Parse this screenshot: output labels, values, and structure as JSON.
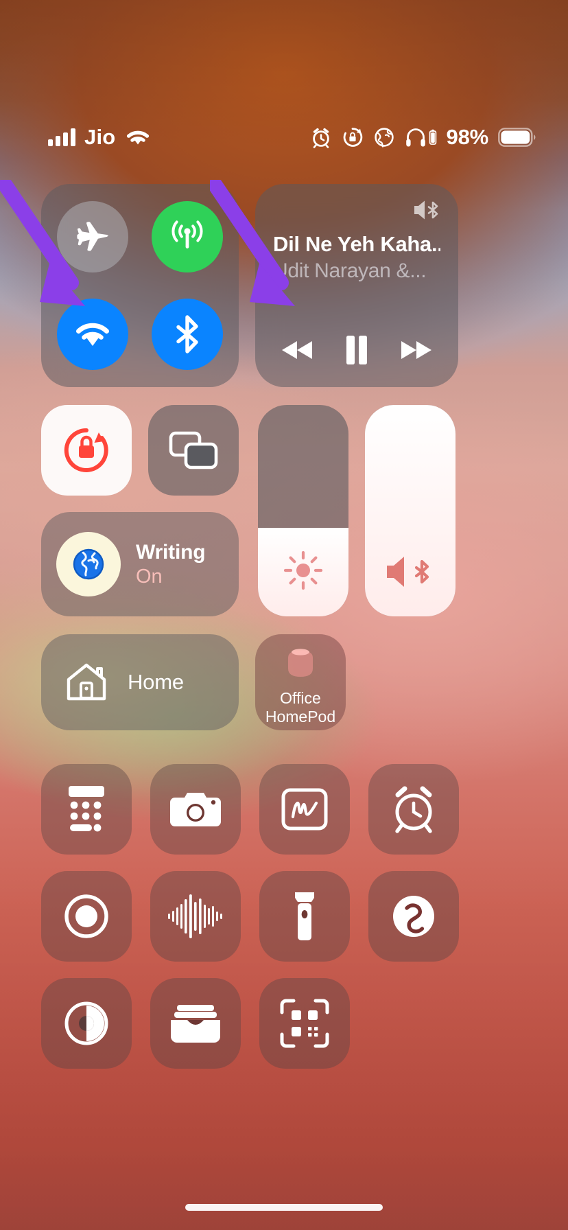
{
  "status_bar": {
    "carrier": "Jio",
    "battery_percent": "98%",
    "icons": [
      "signal-bars-icon",
      "wifi-icon",
      "alarm-icon",
      "rotation-lock-icon",
      "vpn-globe-icon",
      "headphones-battery-icon",
      "battery-icon"
    ]
  },
  "connectivity": {
    "airplane": {
      "name": "Airplane Mode",
      "state": "off",
      "color": "#b0b0b5"
    },
    "cellular": {
      "name": "Cellular Data",
      "state": "on",
      "color": "#2fd158"
    },
    "wifi": {
      "name": "Wi-Fi",
      "state": "on",
      "color": "#0a84ff"
    },
    "bluetooth": {
      "name": "Bluetooth",
      "state": "on",
      "color": "#0a84ff"
    }
  },
  "media": {
    "track_title": "Dil Ne Yeh Kaha...",
    "artist": "Udit Narayan &...",
    "playback_state": "playing",
    "airplay_icon": "airplay-bluetooth-icon",
    "controls": [
      "rewind-button",
      "pause-button",
      "fast-forward-button"
    ]
  },
  "toggles": {
    "rotation_lock": {
      "name": "Rotation Lock",
      "state": "on",
      "color": "#ff3b30"
    },
    "screen_mirroring": {
      "name": "Screen Mirroring",
      "state": "off"
    }
  },
  "focus": {
    "name": "Writing",
    "state": "On",
    "icon": "globe-icon"
  },
  "sliders": {
    "brightness": {
      "name": "Brightness",
      "value_percent": 42,
      "icon": "sun-icon"
    },
    "volume": {
      "name": "Volume",
      "value_percent": 100,
      "icon": "speaker-bluetooth-icon"
    }
  },
  "home": {
    "label": "Home",
    "icon": "house-icon"
  },
  "homepod": {
    "label": "Office\nHomePod",
    "line1": "Office",
    "line2": "HomePod",
    "icon": "homepod-icon"
  },
  "app_shortcuts": [
    {
      "name": "calculator-shortcut",
      "icon": "calculator-icon"
    },
    {
      "name": "camera-shortcut",
      "icon": "camera-icon"
    },
    {
      "name": "quick-note-shortcut",
      "icon": "quick-note-icon"
    },
    {
      "name": "alarm-shortcut",
      "icon": "alarm-clock-icon"
    },
    {
      "name": "screen-record-shortcut",
      "icon": "screen-record-icon"
    },
    {
      "name": "voice-memo-shortcut",
      "icon": "sound-recognition-icon"
    },
    {
      "name": "flashlight-shortcut",
      "icon": "flashlight-icon"
    },
    {
      "name": "shazam-shortcut",
      "icon": "shazam-icon"
    },
    {
      "name": "dark-mode-shortcut",
      "icon": "dark-mode-icon"
    },
    {
      "name": "wallet-shortcut",
      "icon": "wallet-icon"
    },
    {
      "name": "qr-scanner-shortcut",
      "icon": "qr-code-icon"
    }
  ],
  "annotations": {
    "color": "#8b3fe8",
    "arrows": [
      "arrow-to-wifi",
      "arrow-to-bluetooth"
    ]
  }
}
